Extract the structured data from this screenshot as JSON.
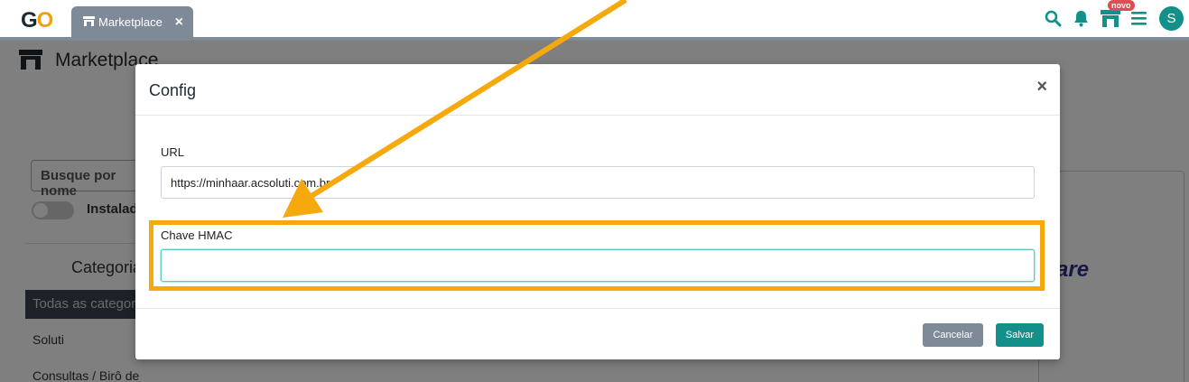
{
  "app": {
    "logo": "GO",
    "tab_label": "Marketplace",
    "tab_close": "×",
    "novo_badge": "novo",
    "avatar_initial": "S",
    "accent_color": "#14908a"
  },
  "page": {
    "title": "Marketplace",
    "search_placeholder": "Busque por nome",
    "installed_label": "Instalados",
    "categories_title": "Categorias",
    "categories": [
      "Todas as categorias",
      "Soluti",
      "Consultas / Birô de"
    ],
    "card_partial_text": "are"
  },
  "modal": {
    "title": "Config",
    "close": "×",
    "url_label": "URL",
    "url_value": "https://minhaar.acsoluti.com.br",
    "hmac_label": "Chave HMAC",
    "hmac_value": "",
    "cancel_label": "Cancelar",
    "save_label": "Salvar"
  },
  "icons": [
    "search-icon",
    "bell-icon",
    "store-icon",
    "menu-icon"
  ],
  "annotation_color": "#f6a90c"
}
